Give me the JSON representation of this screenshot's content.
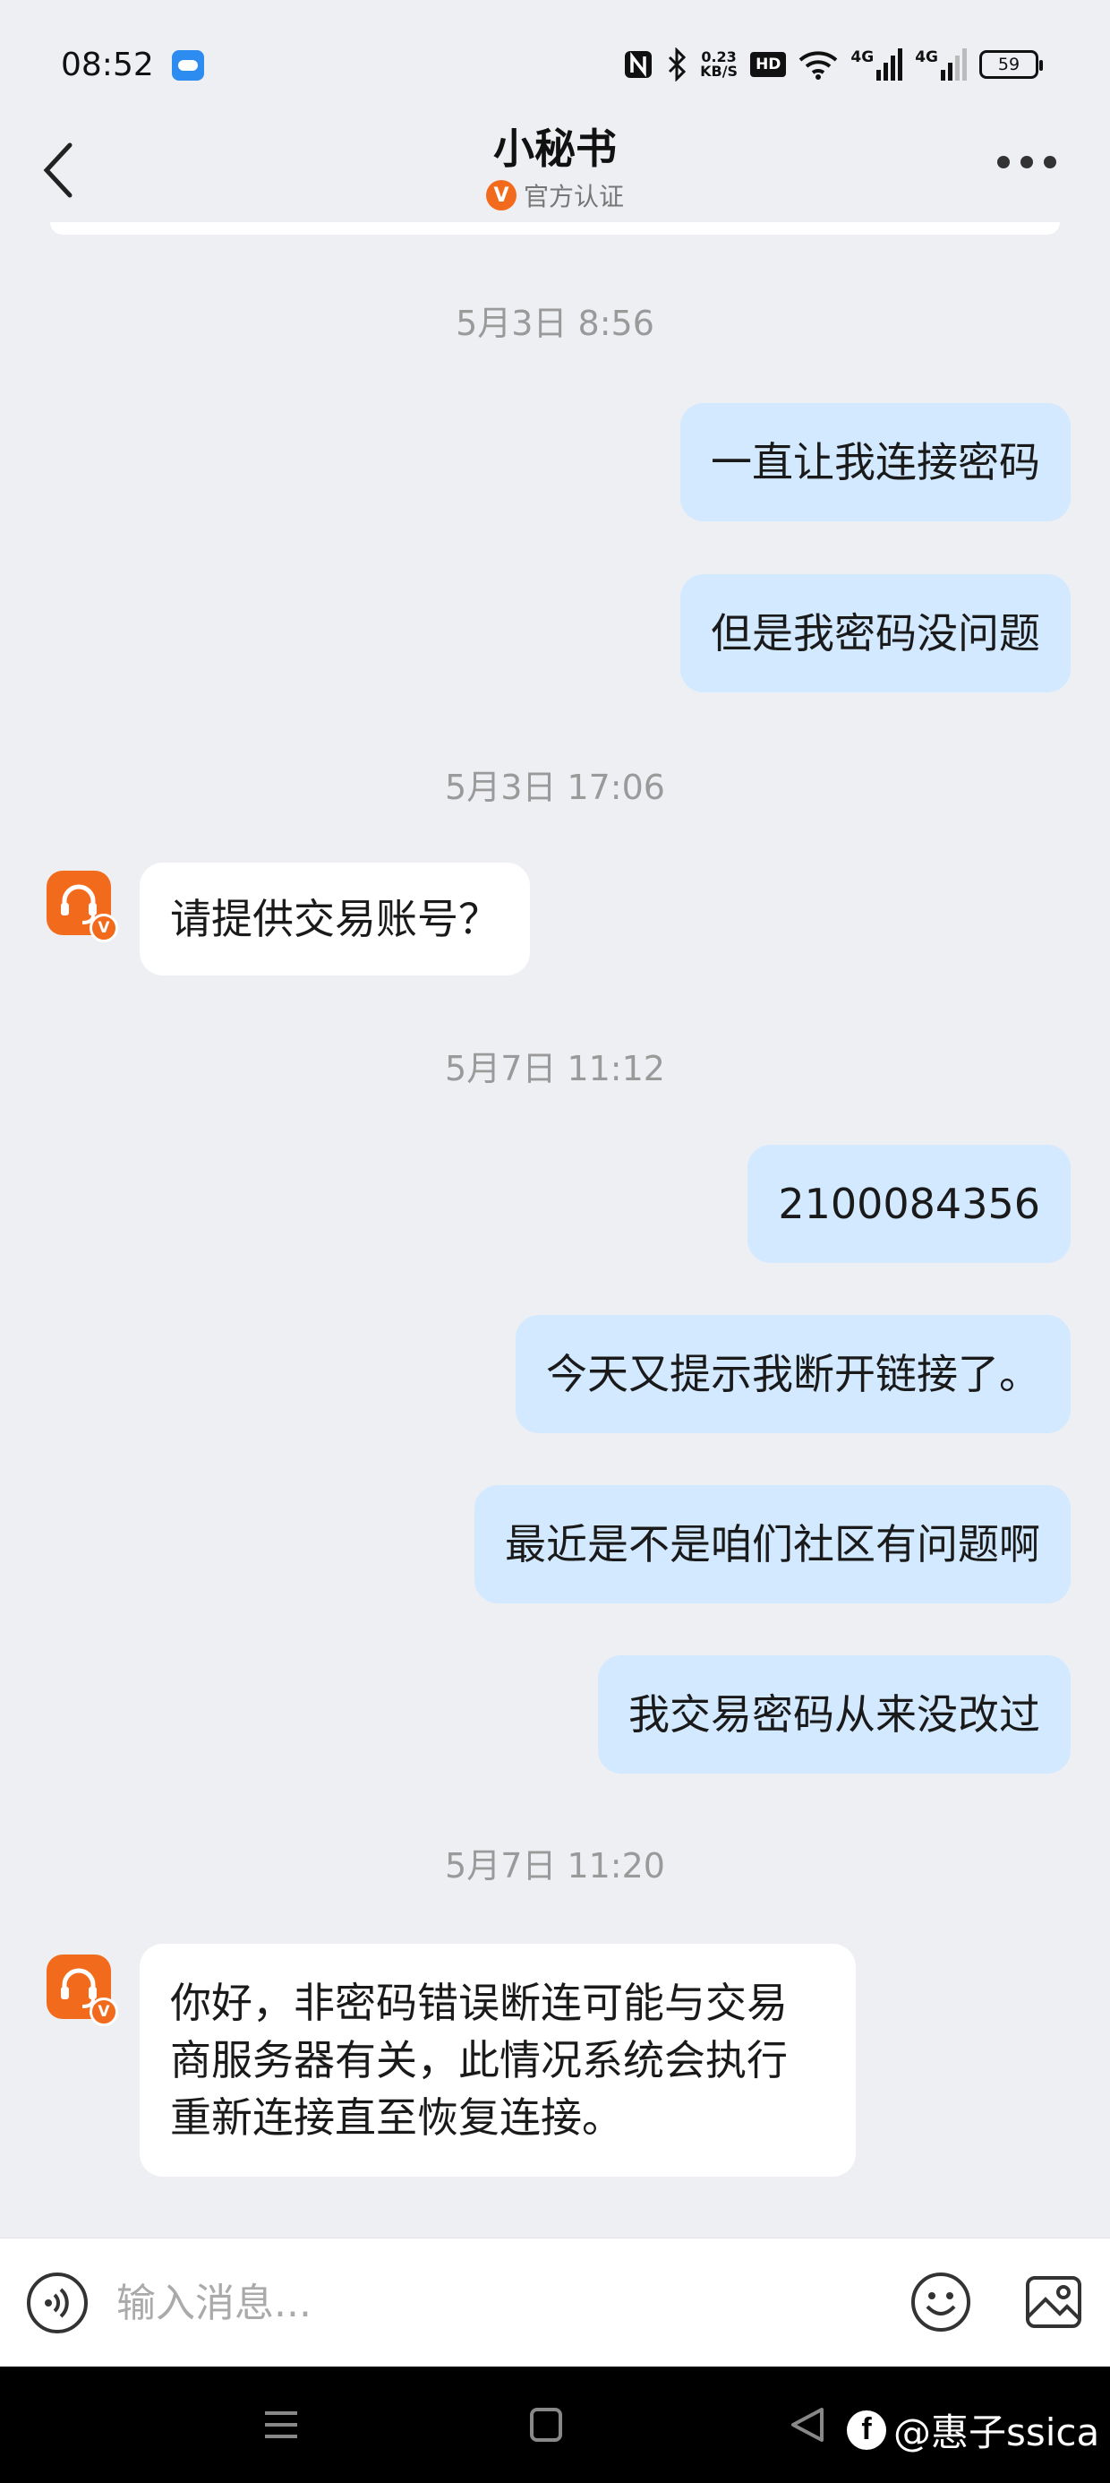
{
  "status_bar": {
    "time": "08:52",
    "net_speed_value": "0.23",
    "net_speed_unit": "KB/S",
    "hd_label": "HD",
    "signal1_label": "4G",
    "signal2_label": "4G",
    "battery": "59"
  },
  "header": {
    "title": "小秘书",
    "verified_badge": "V",
    "verified_text": "官方认证"
  },
  "messages": [
    {
      "type": "timestamp",
      "text": "5月3日 8:56"
    },
    {
      "type": "outgoing",
      "text": "一直让我连接密码"
    },
    {
      "type": "outgoing",
      "text": "但是我密码没问题"
    },
    {
      "type": "timestamp",
      "text": "5月3日 17:06"
    },
    {
      "type": "incoming",
      "text": "请提供交易账号？"
    },
    {
      "type": "timestamp",
      "text": "5月7日 11:12"
    },
    {
      "type": "outgoing",
      "text": "2100084356"
    },
    {
      "type": "outgoing",
      "text": "今天又提示我断开链接了。"
    },
    {
      "type": "outgoing",
      "text": "最近是不是咱们社区有问题啊"
    },
    {
      "type": "outgoing",
      "text": "我交易密码从来没改过"
    },
    {
      "type": "timestamp",
      "text": "5月7日 11:20"
    },
    {
      "type": "incoming",
      "text": "你好，非密码错误断连可能与交易商服务器有关，此情况系统会执行重新连接直至恢复连接。"
    }
  ],
  "avatar_badge": "V",
  "input": {
    "placeholder": "输入消息..."
  },
  "watermark": {
    "icon": "f",
    "text": "@惠子ssica"
  },
  "colors": {
    "outgoing_bubble": "#d3e9ff",
    "incoming_bubble": "#ffffff",
    "accent": "#f26b1d",
    "background": "#eeeff3"
  }
}
